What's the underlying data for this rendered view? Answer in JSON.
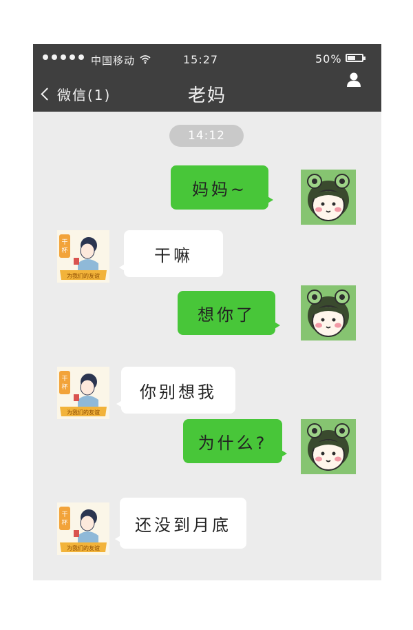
{
  "status_bar": {
    "carrier": "中国移动",
    "time": "15:27",
    "battery": "50%"
  },
  "nav": {
    "back_label": "微信(1)",
    "title": "老妈"
  },
  "chat": {
    "timestamp": "14:12",
    "messages": [
      {
        "side": "me",
        "text": "妈妈~"
      },
      {
        "side": "mom",
        "text": "干嘛"
      },
      {
        "side": "me",
        "text": "想你了"
      },
      {
        "side": "mom",
        "text": "你别想我"
      },
      {
        "side": "me",
        "text": "为什么?"
      },
      {
        "side": "mom",
        "text": "还没到月底"
      }
    ]
  },
  "avatars": {
    "me": "frog-hat-boy-avatar",
    "mom": "cheers-lady-sticker-avatar",
    "mom_sticker_text": "干杯 为我们的友谊"
  },
  "colors": {
    "header": "#3f3f3f",
    "chat_background": "#ececec",
    "outgoing_bubble": "#48c639",
    "incoming_bubble": "#ffffff",
    "timestamp_badge": "#c9c9c9"
  }
}
